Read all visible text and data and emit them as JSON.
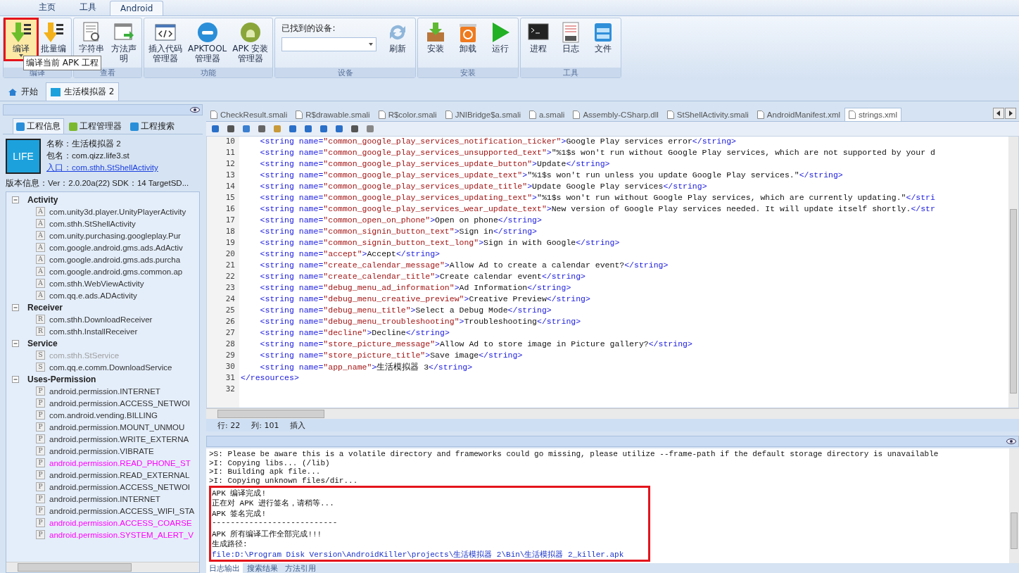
{
  "menu_tabs": [
    {
      "label": "主页",
      "selected": false
    },
    {
      "label": "工具",
      "selected": false
    },
    {
      "label": "Android",
      "selected": true
    }
  ],
  "ribbon_groups": [
    {
      "label": "编译",
      "buttons": [
        {
          "lines": [
            "编译"
          ],
          "highlighted": true,
          "dropdown": true
        },
        {
          "lines": [
            "批量编"
          ],
          "highlighted": false
        }
      ]
    },
    {
      "label": "查看",
      "buttons": [
        {
          "lines": [
            "字符串"
          ],
          "highlighted": false
        },
        {
          "lines": [
            "方法声",
            "明"
          ],
          "highlighted": false
        }
      ]
    },
    {
      "label": "功能",
      "buttons": [
        {
          "lines": [
            "插入代码",
            "管理器"
          ],
          "highlighted": false
        },
        {
          "lines": [
            "APKTOOL",
            "管理器"
          ],
          "highlighted": false
        },
        {
          "lines": [
            "APK 安装",
            "管理器"
          ],
          "highlighted": false
        }
      ]
    },
    {
      "label": "设备",
      "device_label": "已找到的设备:",
      "buttons": [
        {
          "lines": [
            "刷新"
          ],
          "highlighted": false
        }
      ]
    },
    {
      "label": "安装",
      "buttons": [
        {
          "lines": [
            "安装"
          ],
          "highlighted": false
        },
        {
          "lines": [
            "卸载"
          ],
          "highlighted": false
        },
        {
          "lines": [
            "运行"
          ],
          "highlighted": false
        }
      ]
    },
    {
      "label": "工具",
      "buttons": [
        {
          "lines": [
            "进程"
          ],
          "highlighted": false
        },
        {
          "lines": [
            "日志"
          ],
          "highlighted": false
        },
        {
          "lines": [
            "文件"
          ],
          "highlighted": false
        }
      ]
    }
  ],
  "tooltip": "编译当前 APK 工程",
  "doc_tabs": [
    {
      "label": "开始",
      "selected": false
    },
    {
      "label": "生活模拟器 2",
      "selected": true
    }
  ],
  "left_panel": {
    "tabs": [
      {
        "label": "工程信息",
        "selected": true
      },
      {
        "label": "工程管理器",
        "selected": false
      },
      {
        "label": "工程搜索",
        "selected": false
      }
    ],
    "app_icon_text": "LIFE",
    "info": [
      {
        "label": "名称：生活模拟器 2",
        "link": false
      },
      {
        "label": "包名：com.qizz.life3.st",
        "link": false
      },
      {
        "label": "入口：com.sthh.StShellActivity",
        "link": true
      }
    ],
    "version": "版本信息：Ver：2.0.20a(22) SDK：14 TargetSD...",
    "tree": [
      {
        "label": "Activity",
        "expanded": true,
        "children": [
          {
            "icon": "A",
            "label": "com.unity3d.player.UnityPlayerActivity",
            "color": "#333333"
          },
          {
            "icon": "A",
            "label": "com.sthh.StShellActivity",
            "color": "#333333"
          },
          {
            "icon": "A",
            "label": "com.unity.purchasing.googleplay.Pur",
            "color": "#333333"
          },
          {
            "icon": "A",
            "label": "com.google.android.gms.ads.AdActiv",
            "color": "#333333"
          },
          {
            "icon": "A",
            "label": "com.google.android.gms.ads.purcha",
            "color": "#333333"
          },
          {
            "icon": "A",
            "label": "com.google.android.gms.common.ap",
            "color": "#333333"
          },
          {
            "icon": "A",
            "label": "com.sthh.WebViewActivity",
            "color": "#333333"
          },
          {
            "icon": "A",
            "label": "com.qq.e.ads.ADActivity",
            "color": "#333333"
          }
        ]
      },
      {
        "label": "Receiver",
        "expanded": true,
        "children": [
          {
            "icon": "R",
            "label": "com.sthh.DownloadReceiver",
            "color": "#333333"
          },
          {
            "icon": "R",
            "label": "com.sthh.InstallReceiver",
            "color": "#333333"
          }
        ]
      },
      {
        "label": "Service",
        "expanded": true,
        "children": [
          {
            "icon": "S",
            "label": "com.sthh.StService",
            "color": "#a0a0a0"
          },
          {
            "icon": "S",
            "label": "com.qq.e.comm.DownloadService",
            "color": "#333333"
          }
        ]
      },
      {
        "label": "Uses-Permission",
        "expanded": true,
        "children": [
          {
            "icon": "P",
            "label": "android.permission.INTERNET",
            "color": "#333333"
          },
          {
            "icon": "P",
            "label": "android.permission.ACCESS_NETWOI",
            "color": "#333333"
          },
          {
            "icon": "P",
            "label": "com.android.vending.BILLING",
            "color": "#333333"
          },
          {
            "icon": "P",
            "label": "android.permission.MOUNT_UNMOU",
            "color": "#333333"
          },
          {
            "icon": "P",
            "label": "android.permission.WRITE_EXTERNA",
            "color": "#333333"
          },
          {
            "icon": "P",
            "label": "android.permission.VIBRATE",
            "color": "#333333"
          },
          {
            "icon": "P",
            "label": "android.permission.READ_PHONE_ST",
            "color": "#ff00ff"
          },
          {
            "icon": "P",
            "label": "android.permission.READ_EXTERNAL",
            "color": "#333333"
          },
          {
            "icon": "P",
            "label": "android.permission.ACCESS_NETWOI",
            "color": "#333333"
          },
          {
            "icon": "P",
            "label": "android.permission.INTERNET",
            "color": "#333333"
          },
          {
            "icon": "P",
            "label": "android.permission.ACCESS_WIFI_STA",
            "color": "#333333"
          },
          {
            "icon": "P",
            "label": "android.permission.ACCESS_COARSE",
            "color": "#ff00ff"
          },
          {
            "icon": "P",
            "label": "android.permission.SYSTEM_ALERT_V",
            "color": "#ff00ff"
          }
        ]
      }
    ]
  },
  "editor_tabs": [
    {
      "label": "CheckResult.smali",
      "selected": false
    },
    {
      "label": "R$drawable.smali",
      "selected": false
    },
    {
      "label": "R$color.smali",
      "selected": false
    },
    {
      "label": "JNIBridge$a.smali",
      "selected": false
    },
    {
      "label": "a.smali",
      "selected": false
    },
    {
      "label": "Assembly-CSharp.dll",
      "selected": false
    },
    {
      "label": "StShellActivity.smali",
      "selected": false
    },
    {
      "label": "AndroidManifest.xml",
      "selected": false
    },
    {
      "label": "strings.xml",
      "selected": true
    }
  ],
  "code_lines": [
    {
      "n": "10",
      "t": [
        {
          "kind": "tag",
          "text": "    <string name="
        },
        {
          "kind": "val",
          "text": "\"common_google_play_services_notification_ticker\""
        },
        {
          "kind": "tag",
          "text": ">"
        },
        {
          "kind": "txt",
          "text": "Google Play services error"
        },
        {
          "kind": "tag",
          "text": "</string>"
        }
      ]
    },
    {
      "n": "11",
      "t": [
        {
          "kind": "tag",
          "text": "    <string name="
        },
        {
          "kind": "val",
          "text": "\"common_google_play_services_unsupported_text\""
        },
        {
          "kind": "tag",
          "text": ">"
        },
        {
          "kind": "txt",
          "text": "\"%1$s won't run without Google Play services, which are not supported by your d"
        }
      ]
    },
    {
      "n": "12",
      "t": [
        {
          "kind": "tag",
          "text": "    <string name="
        },
        {
          "kind": "val",
          "text": "\"common_google_play_services_update_button\""
        },
        {
          "kind": "tag",
          "text": ">"
        },
        {
          "kind": "txt",
          "text": "Update"
        },
        {
          "kind": "tag",
          "text": "</string>"
        }
      ]
    },
    {
      "n": "13",
      "t": [
        {
          "kind": "tag",
          "text": "    <string name="
        },
        {
          "kind": "val",
          "text": "\"common_google_play_services_update_text\""
        },
        {
          "kind": "tag",
          "text": ">"
        },
        {
          "kind": "txt",
          "text": "\"%1$s won't run unless you update Google Play services.\""
        },
        {
          "kind": "tag",
          "text": "</string>"
        }
      ]
    },
    {
      "n": "14",
      "t": [
        {
          "kind": "tag",
          "text": "    <string name="
        },
        {
          "kind": "val",
          "text": "\"common_google_play_services_update_title\""
        },
        {
          "kind": "tag",
          "text": ">"
        },
        {
          "kind": "txt",
          "text": "Update Google Play services"
        },
        {
          "kind": "tag",
          "text": "</string>"
        }
      ]
    },
    {
      "n": "15",
      "t": [
        {
          "kind": "tag",
          "text": "    <string name="
        },
        {
          "kind": "val",
          "text": "\"common_google_play_services_updating_text\""
        },
        {
          "kind": "tag",
          "text": ">"
        },
        {
          "kind": "txt",
          "text": "\"%1$s won't run without Google Play services, which are currently updating.\""
        },
        {
          "kind": "tag",
          "text": "</stri"
        }
      ]
    },
    {
      "n": "16",
      "t": [
        {
          "kind": "tag",
          "text": "    <string name="
        },
        {
          "kind": "val",
          "text": "\"common_google_play_services_wear_update_text\""
        },
        {
          "kind": "tag",
          "text": ">"
        },
        {
          "kind": "txt",
          "text": "New version of Google Play services needed. It will update itself shortly."
        },
        {
          "kind": "tag",
          "text": "</str"
        }
      ]
    },
    {
      "n": "17",
      "t": [
        {
          "kind": "tag",
          "text": "    <string name="
        },
        {
          "kind": "val",
          "text": "\"common_open_on_phone\""
        },
        {
          "kind": "tag",
          "text": ">"
        },
        {
          "kind": "txt",
          "text": "Open on phone"
        },
        {
          "kind": "tag",
          "text": "</string>"
        }
      ]
    },
    {
      "n": "18",
      "t": [
        {
          "kind": "tag",
          "text": "    <string name="
        },
        {
          "kind": "val",
          "text": "\"common_signin_button_text\""
        },
        {
          "kind": "tag",
          "text": ">"
        },
        {
          "kind": "txt",
          "text": "Sign in"
        },
        {
          "kind": "tag",
          "text": "</string>"
        }
      ]
    },
    {
      "n": "19",
      "t": [
        {
          "kind": "tag",
          "text": "    <string name="
        },
        {
          "kind": "val",
          "text": "\"common_signin_button_text_long\""
        },
        {
          "kind": "tag",
          "text": ">"
        },
        {
          "kind": "txt",
          "text": "Sign in with Google"
        },
        {
          "kind": "tag",
          "text": "</string>"
        }
      ]
    },
    {
      "n": "20",
      "t": [
        {
          "kind": "tag",
          "text": "    <string name="
        },
        {
          "kind": "val",
          "text": "\"accept\""
        },
        {
          "kind": "tag",
          "text": ">"
        },
        {
          "kind": "txt",
          "text": "Accept"
        },
        {
          "kind": "tag",
          "text": "</string>"
        }
      ]
    },
    {
      "n": "21",
      "t": [
        {
          "kind": "tag",
          "text": "    <string name="
        },
        {
          "kind": "val",
          "text": "\"create_calendar_message\""
        },
        {
          "kind": "tag",
          "text": ">"
        },
        {
          "kind": "txt",
          "text": "Allow Ad to create a calendar event?"
        },
        {
          "kind": "tag",
          "text": "</string>"
        }
      ]
    },
    {
      "n": "22",
      "t": [
        {
          "kind": "tag",
          "text": "    <string name="
        },
        {
          "kind": "val",
          "text": "\"create_calendar_title\""
        },
        {
          "kind": "tag",
          "text": ">"
        },
        {
          "kind": "txt",
          "text": "Create calendar event"
        },
        {
          "kind": "tag",
          "text": "</string>"
        }
      ]
    },
    {
      "n": "23",
      "t": [
        {
          "kind": "tag",
          "text": "    <string name="
        },
        {
          "kind": "val",
          "text": "\"debug_menu_ad_information\""
        },
        {
          "kind": "tag",
          "text": ">"
        },
        {
          "kind": "txt",
          "text": "Ad Information"
        },
        {
          "kind": "tag",
          "text": "</string>"
        }
      ]
    },
    {
      "n": "24",
      "t": [
        {
          "kind": "tag",
          "text": "    <string name="
        },
        {
          "kind": "val",
          "text": "\"debug_menu_creative_preview\""
        },
        {
          "kind": "tag",
          "text": ">"
        },
        {
          "kind": "txt",
          "text": "Creative Preview"
        },
        {
          "kind": "tag",
          "text": "</string>"
        }
      ]
    },
    {
      "n": "25",
      "t": [
        {
          "kind": "tag",
          "text": "    <string name="
        },
        {
          "kind": "val",
          "text": "\"debug_menu_title\""
        },
        {
          "kind": "tag",
          "text": ">"
        },
        {
          "kind": "txt",
          "text": "Select a Debug Mode"
        },
        {
          "kind": "tag",
          "text": "</string>"
        }
      ]
    },
    {
      "n": "26",
      "t": [
        {
          "kind": "tag",
          "text": "    <string name="
        },
        {
          "kind": "val",
          "text": "\"debug_menu_troubleshooting\""
        },
        {
          "kind": "tag",
          "text": ">"
        },
        {
          "kind": "txt",
          "text": "Troubleshooting"
        },
        {
          "kind": "tag",
          "text": "</string>"
        }
      ]
    },
    {
      "n": "27",
      "t": [
        {
          "kind": "tag",
          "text": "    <string name="
        },
        {
          "kind": "val",
          "text": "\"decline\""
        },
        {
          "kind": "tag",
          "text": ">"
        },
        {
          "kind": "txt",
          "text": "Decline"
        },
        {
          "kind": "tag",
          "text": "</string>"
        }
      ]
    },
    {
      "n": "28",
      "t": [
        {
          "kind": "tag",
          "text": "    <string name="
        },
        {
          "kind": "val",
          "text": "\"store_picture_message\""
        },
        {
          "kind": "tag",
          "text": ">"
        },
        {
          "kind": "txt",
          "text": "Allow Ad to store image in Picture gallery?"
        },
        {
          "kind": "tag",
          "text": "</string>"
        }
      ]
    },
    {
      "n": "29",
      "t": [
        {
          "kind": "tag",
          "text": "    <string name="
        },
        {
          "kind": "val",
          "text": "\"store_picture_title\""
        },
        {
          "kind": "tag",
          "text": ">"
        },
        {
          "kind": "txt",
          "text": "Save image"
        },
        {
          "kind": "tag",
          "text": "</string>"
        }
      ]
    },
    {
      "n": "30",
      "t": [
        {
          "kind": "tag",
          "text": "    <string name="
        },
        {
          "kind": "val",
          "text": "\"app_name\""
        },
        {
          "kind": "tag",
          "text": ">"
        },
        {
          "kind": "txt",
          "text": "生活模拟器 3"
        },
        {
          "kind": "tag",
          "text": "</string>"
        }
      ]
    },
    {
      "n": "31",
      "t": [
        {
          "kind": "tag",
          "text": "</resources>"
        }
      ]
    },
    {
      "n": "32"
    }
  ],
  "status_bar": [
    "行: 22",
    "列: 101",
    "插入"
  ],
  "log_lines": [
    {
      "text": ">S: Please be aware this is a volatile directory and frameworks could go missing, please utilize --frame-path if the default storage directory is unavailable",
      "highlighted": false,
      "link": false
    },
    {
      "text": ">I: Copying libs... (/lib)",
      "highlighted": false,
      "link": false
    },
    {
      "text": ">I: Building apk file...",
      "highlighted": false,
      "link": false
    },
    {
      "text": ">I: Copying unknown files/dir...",
      "highlighted": false,
      "link": false
    },
    {
      "text": "APK 编译完成!",
      "highlighted": true,
      "link": false
    },
    {
      "text": "正在对 APK 进行签名，请稍等...",
      "highlighted": true,
      "link": false
    },
    {
      "text": "APK 签名完成!",
      "highlighted": true,
      "link": false
    },
    {
      "text": "---------------------------",
      "highlighted": true,
      "link": false
    },
    {
      "text": "APK 所有编译工作全部完成!!!",
      "highlighted": true,
      "link": false
    },
    {
      "text": "生成路径:",
      "highlighted": true,
      "link": false
    },
    {
      "text": "file:D:\\Program Disk Version\\AndroidKiller\\projects\\生活模拟器 2\\Bin\\生活模拟器 2_killer.apk",
      "highlighted": true,
      "link": true
    }
  ],
  "bottom_tabs": [
    {
      "label": "日志输出",
      "selected": true
    },
    {
      "label": "搜索结果",
      "selected": false
    },
    {
      "label": "方法引用",
      "selected": false
    }
  ]
}
